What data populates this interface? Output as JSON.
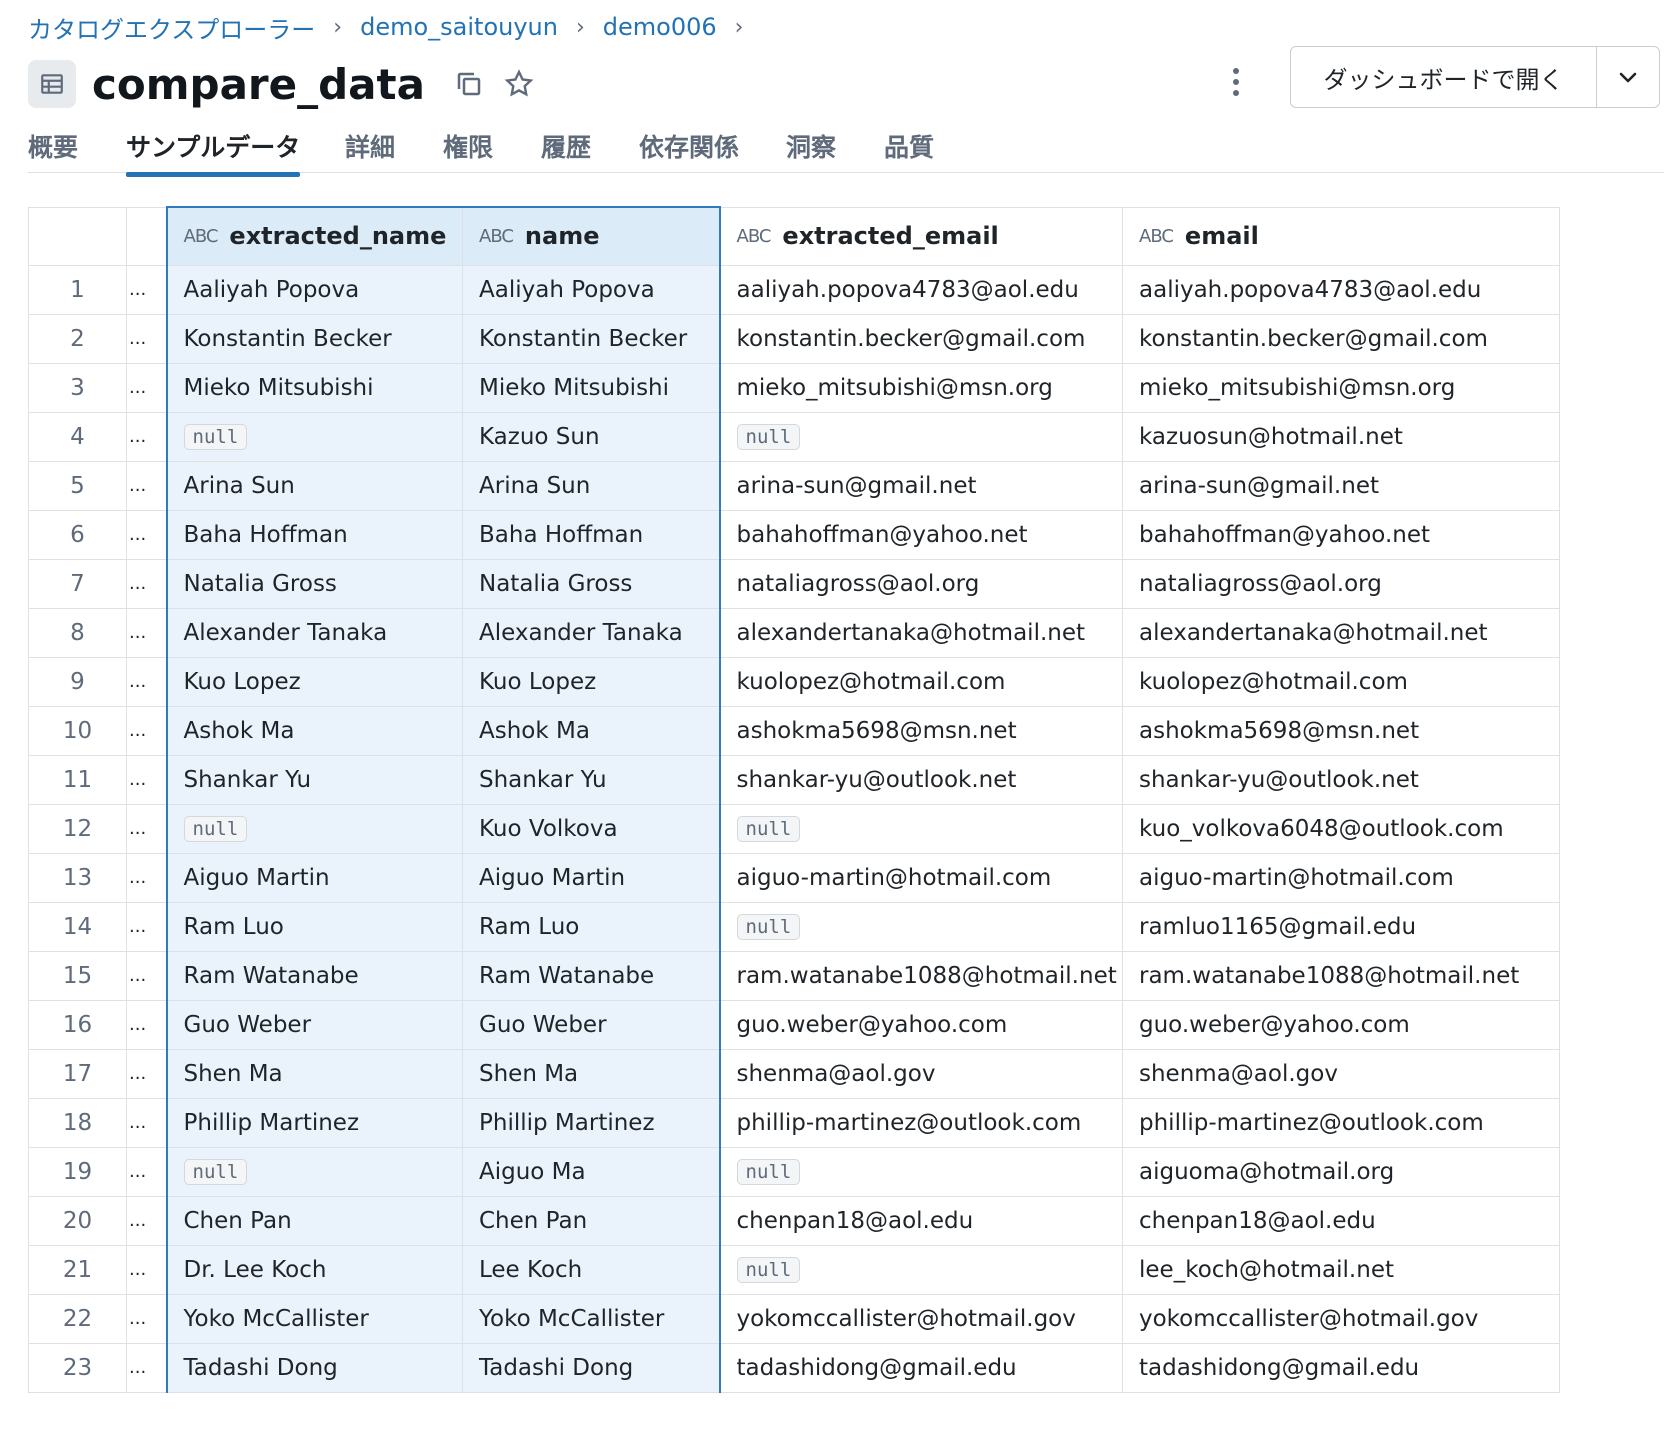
{
  "breadcrumb": [
    "カタログエクスプローラー",
    "demo_saitouyun",
    "demo006"
  ],
  "breadcrumb_sep": "›",
  "title": "compare_data",
  "dashboard_button": "ダッシュボードで開く",
  "tabs": [
    "概要",
    "サンプルデータ",
    "詳細",
    "権限",
    "履歴",
    "依存関係",
    "洞察",
    "品質"
  ],
  "active_tab": "サンプルデータ",
  "table": {
    "type_icon_text": "ABC",
    "columns": [
      "extracted_name",
      "name",
      "extracted_email",
      "email"
    ],
    "null_text": "null",
    "truncated_text": "...",
    "rows": [
      {
        "idx": "1",
        "extracted_name": "Aaliyah Popova",
        "name": "Aaliyah Popova",
        "extracted_email": "aaliyah.popova4783@aol.edu",
        "email": "aaliyah.popova4783@aol.edu"
      },
      {
        "idx": "2",
        "extracted_name": "Konstantin Becker",
        "name": "Konstantin Becker",
        "extracted_email": "konstantin.becker@gmail.com",
        "email": "konstantin.becker@gmail.com"
      },
      {
        "idx": "3",
        "extracted_name": "Mieko Mitsubishi",
        "name": "Mieko Mitsubishi",
        "extracted_email": "mieko_mitsubishi@msn.org",
        "email": "mieko_mitsubishi@msn.org"
      },
      {
        "idx": "4",
        "extracted_name": null,
        "name": "Kazuo Sun",
        "extracted_email": null,
        "email": "kazuosun@hotmail.net"
      },
      {
        "idx": "5",
        "extracted_name": "Arina Sun",
        "name": "Arina Sun",
        "extracted_email": "arina-sun@gmail.net",
        "email": "arina-sun@gmail.net"
      },
      {
        "idx": "6",
        "extracted_name": "Baha Hoffman",
        "name": "Baha Hoffman",
        "extracted_email": "bahahoffman@yahoo.net",
        "email": "bahahoffman@yahoo.net"
      },
      {
        "idx": "7",
        "extracted_name": "Natalia Gross",
        "name": "Natalia Gross",
        "extracted_email": "nataliagross@aol.org",
        "email": "nataliagross@aol.org"
      },
      {
        "idx": "8",
        "extracted_name": "Alexander Tanaka",
        "name": "Alexander Tanaka",
        "extracted_email": "alexandertanaka@hotmail.net",
        "email": "alexandertanaka@hotmail.net"
      },
      {
        "idx": "9",
        "extracted_name": "Kuo Lopez",
        "name": "Kuo Lopez",
        "extracted_email": "kuolopez@hotmail.com",
        "email": "kuolopez@hotmail.com"
      },
      {
        "idx": "10",
        "extracted_name": "Ashok Ma",
        "name": "Ashok Ma",
        "extracted_email": "ashokma5698@msn.net",
        "email": "ashokma5698@msn.net"
      },
      {
        "idx": "11",
        "extracted_name": "Shankar Yu",
        "name": "Shankar Yu",
        "extracted_email": "shankar-yu@outlook.net",
        "email": "shankar-yu@outlook.net"
      },
      {
        "idx": "12",
        "extracted_name": null,
        "name": "Kuo Volkova",
        "extracted_email": null,
        "email": "kuo_volkova6048@outlook.com"
      },
      {
        "idx": "13",
        "extracted_name": "Aiguo Martin",
        "name": "Aiguo Martin",
        "extracted_email": "aiguo-martin@hotmail.com",
        "email": "aiguo-martin@hotmail.com"
      },
      {
        "idx": "14",
        "extracted_name": "Ram Luo",
        "name": "Ram Luo",
        "extracted_email": null,
        "email": "ramluo1165@gmail.edu"
      },
      {
        "idx": "15",
        "extracted_name": "Ram Watanabe",
        "name": "Ram Watanabe",
        "extracted_email": "ram.watanabe1088@hotmail.net",
        "email": "ram.watanabe1088@hotmail.net"
      },
      {
        "idx": "16",
        "extracted_name": "Guo Weber",
        "name": "Guo Weber",
        "extracted_email": "guo.weber@yahoo.com",
        "email": "guo.weber@yahoo.com"
      },
      {
        "idx": "17",
        "extracted_name": "Shen Ma",
        "name": "Shen Ma",
        "extracted_email": "shenma@aol.gov",
        "email": "shenma@aol.gov"
      },
      {
        "idx": "18",
        "extracted_name": "Phillip Martinez",
        "name": "Phillip Martinez",
        "extracted_email": "phillip-martinez@outlook.com",
        "email": "phillip-martinez@outlook.com"
      },
      {
        "idx": "19",
        "extracted_name": null,
        "name": "Aiguo Ma",
        "extracted_email": null,
        "email": "aiguoma@hotmail.org"
      },
      {
        "idx": "20",
        "extracted_name": "Chen Pan",
        "name": "Chen Pan",
        "extracted_email": "chenpan18@aol.edu",
        "email": "chenpan18@aol.edu"
      },
      {
        "idx": "21",
        "extracted_name": "Dr. Lee Koch",
        "name": "Lee Koch",
        "extracted_email": null,
        "email": "lee_koch@hotmail.net"
      },
      {
        "idx": "22",
        "extracted_name": "Yoko McCallister",
        "name": "Yoko McCallister",
        "extracted_email": "yokomccallister@hotmail.gov",
        "email": "yokomccallister@hotmail.gov"
      },
      {
        "idx": "23",
        "extracted_name": "Tadashi Dong",
        "name": "Tadashi Dong",
        "extracted_email": "tadashidong@gmail.edu",
        "email": "tadashidong@gmail.edu"
      }
    ]
  },
  "colors": {
    "accent": "#2272b4",
    "selection_bg": "#eaf3fb",
    "selection_border": "#2f7ac0"
  },
  "icons": {
    "table": "table-icon",
    "copy": "copy-icon",
    "favorite": "star-icon",
    "more": "kebab-icon",
    "dropdown": "chevron-down-icon"
  }
}
